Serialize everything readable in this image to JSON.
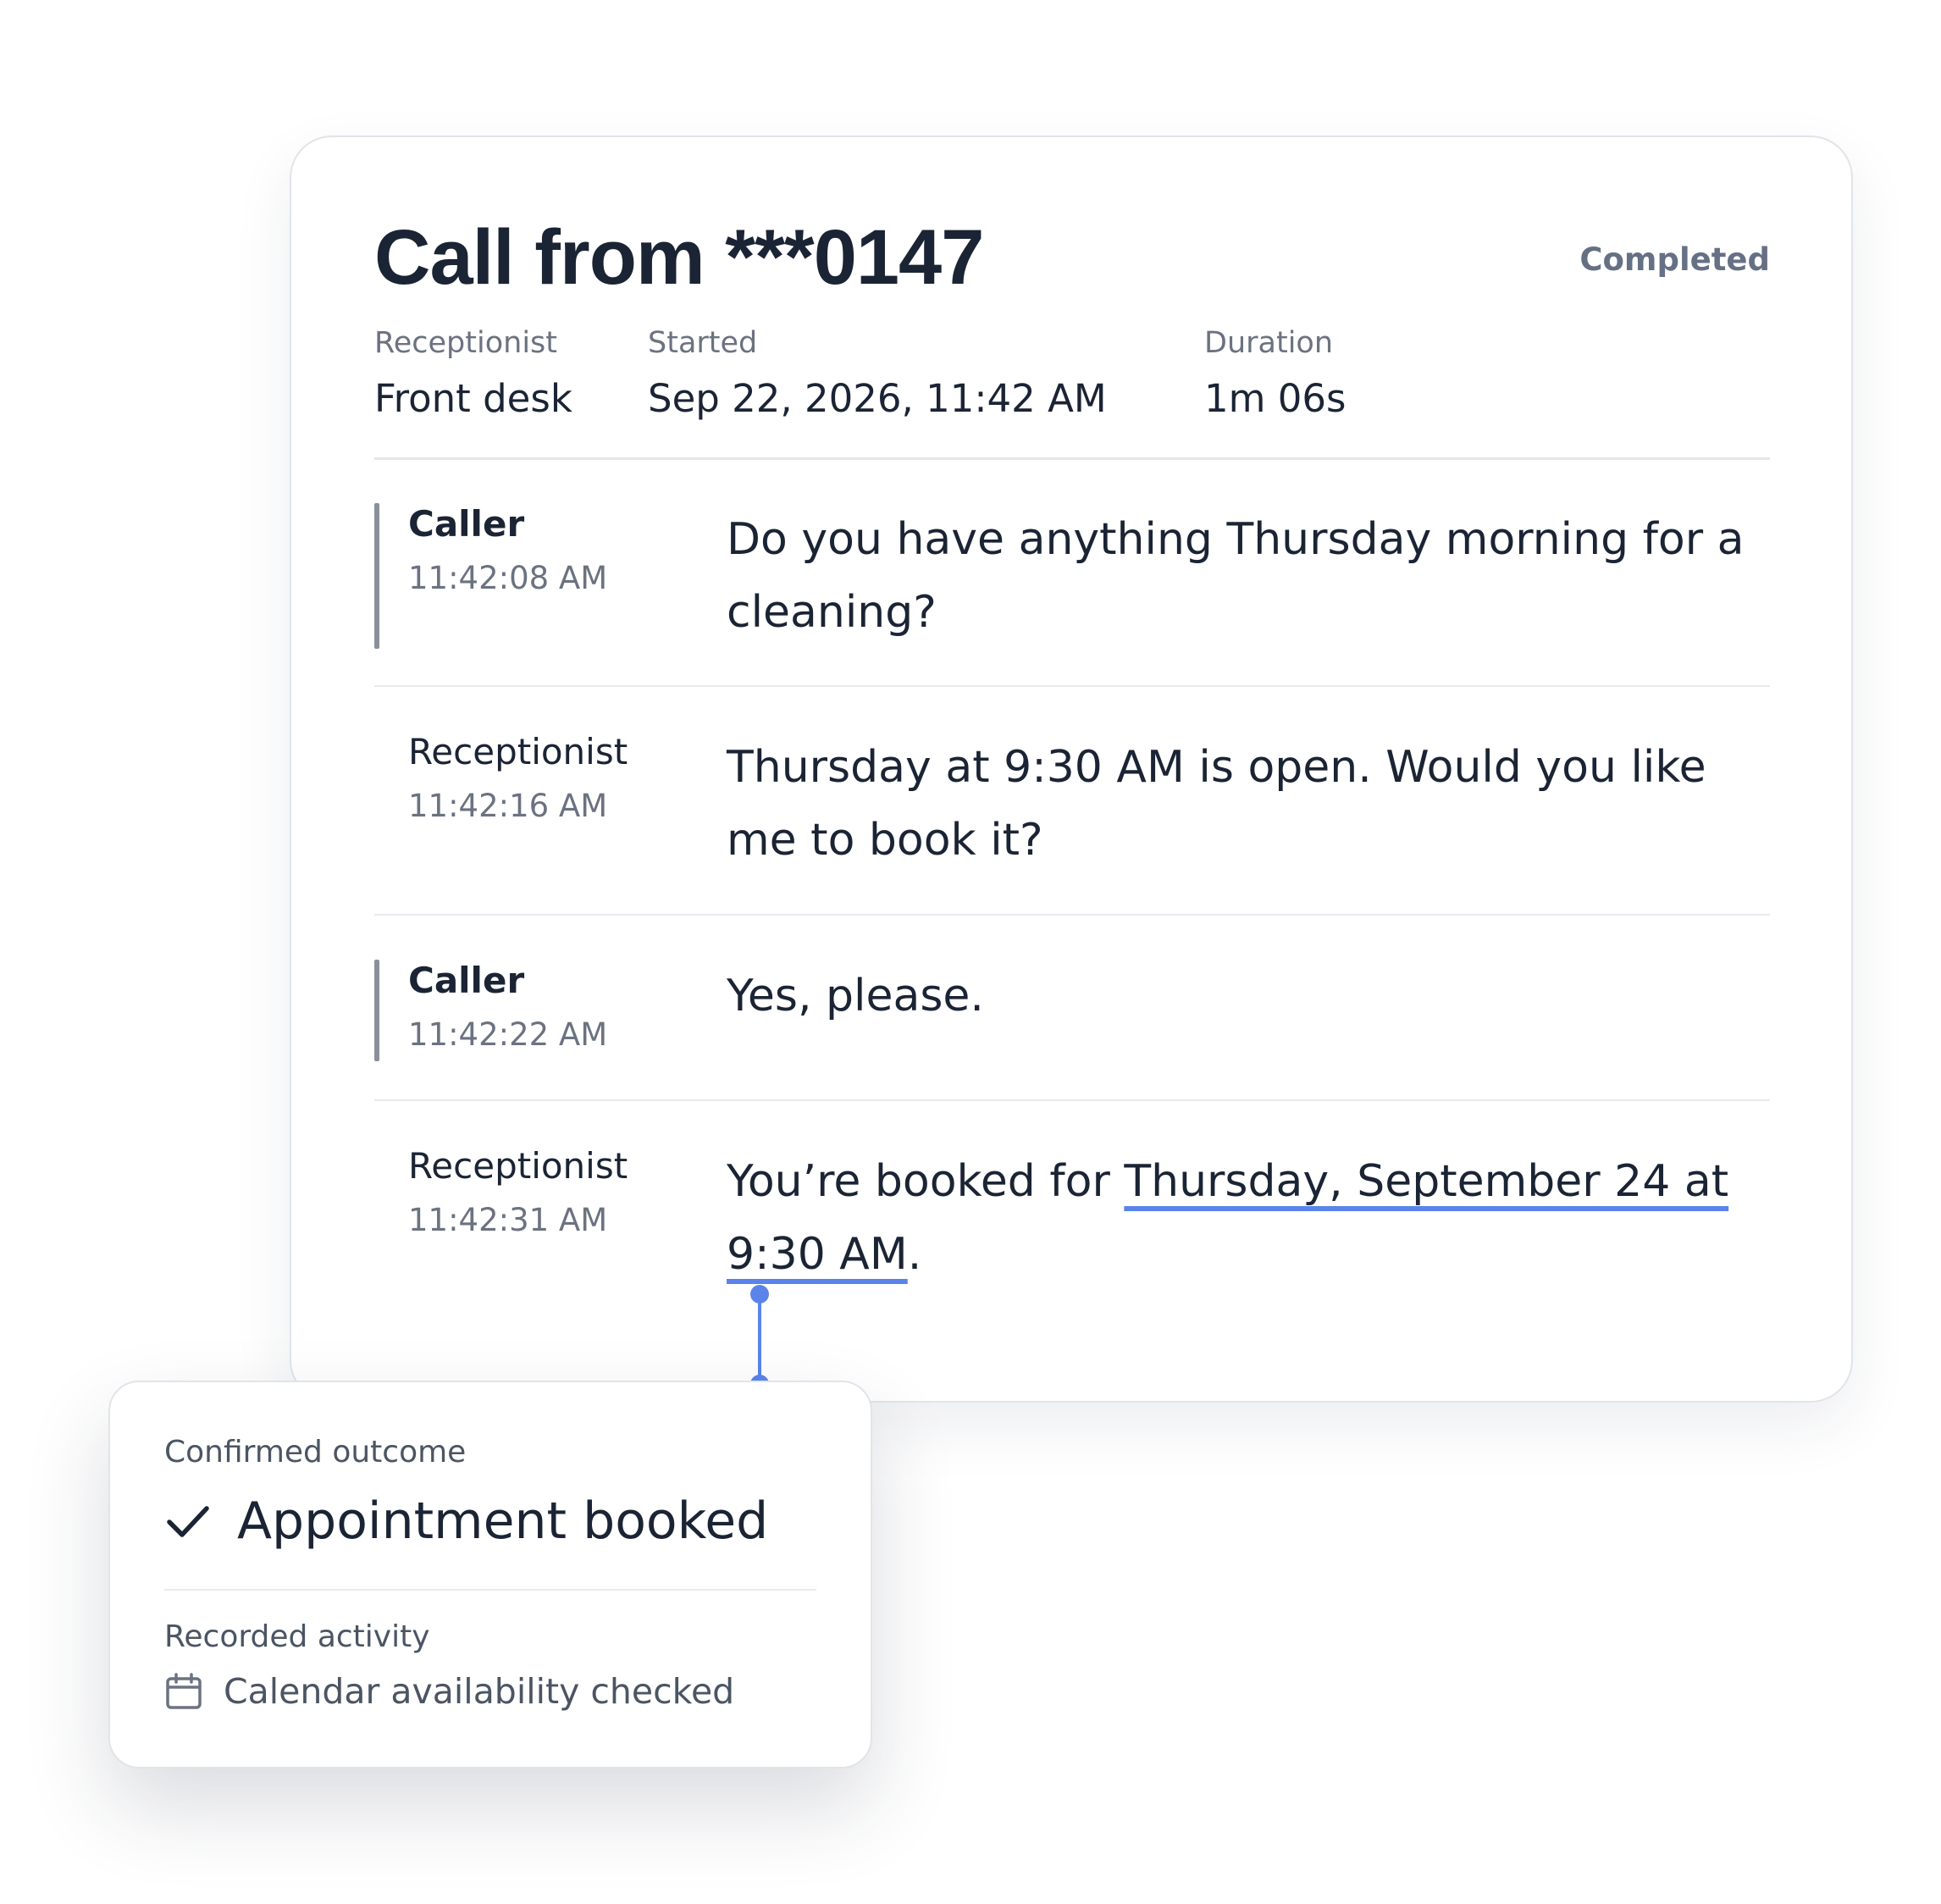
{
  "call": {
    "title": "Call from ***0147",
    "status": "Completed",
    "meta": {
      "receptionist_label": "Receptionist",
      "receptionist_value": "Front desk",
      "started_label": "Started",
      "started_value": "Sep 22, 2026, 11:42 AM",
      "duration_label": "Duration",
      "duration_value": "1m 06s"
    }
  },
  "transcript": [
    {
      "speaker": "Caller",
      "time": "11:42:08 AM",
      "text": "Do you have anything Thursday morning for a cleaning?"
    },
    {
      "speaker": "Receptionist",
      "time": "11:42:16 AM",
      "text": "Thursday at 9:30 AM is open. Would you like me to book it?"
    },
    {
      "speaker": "Caller",
      "time": "11:42:22 AM",
      "text": "Yes, please."
    },
    {
      "speaker": "Receptionist",
      "time": "11:42:31 AM",
      "text_prefix": "You’re booked for ",
      "text_highlight": "Thursday, September 24 at 9:30 AM",
      "text_suffix": "."
    }
  ],
  "outcome": {
    "label": "Confirmed outcome",
    "icon": "check-icon",
    "value": "Appointment booked",
    "activity_label": "Recorded activity",
    "activity_icon": "calendar-icon",
    "activity_value": "Calendar availability checked"
  },
  "colors": {
    "accent": "#5b84ea",
    "text": "#1b2434",
    "muted": "#6b7280",
    "caller_bar": "#8a909b"
  }
}
